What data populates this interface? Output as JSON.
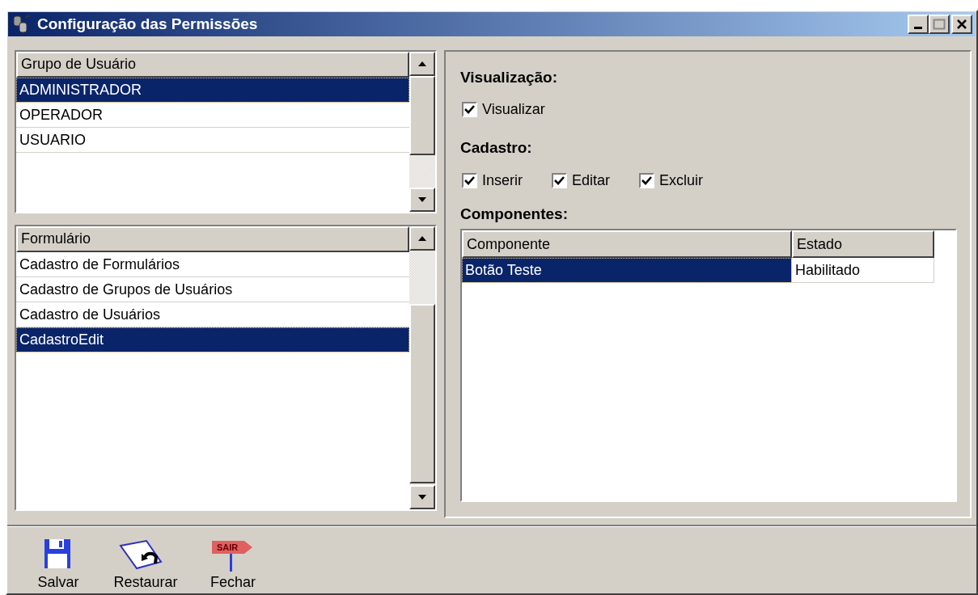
{
  "window": {
    "title": "Configuração das Permissões"
  },
  "user_groups": {
    "header": "Grupo de Usuário",
    "items": [
      {
        "label": "ADMINISTRADOR",
        "selected": true
      },
      {
        "label": "OPERADOR",
        "selected": false
      },
      {
        "label": "USUARIO",
        "selected": false
      }
    ]
  },
  "forms": {
    "header": "Formulário",
    "items": [
      {
        "label": "Cadastro de Formulários",
        "selected": false
      },
      {
        "label": "Cadastro de Grupos de Usuários",
        "selected": false
      },
      {
        "label": "Cadastro de Usuários",
        "selected": false
      },
      {
        "label": "CadastroEdit",
        "selected": true
      }
    ]
  },
  "sections": [
    {
      "title": "Visualização:",
      "options": [
        {
          "label": "Visualizar",
          "checked": true
        }
      ]
    },
    {
      "title": "Cadastro:",
      "options": [
        {
          "label": "Inserir",
          "checked": true
        },
        {
          "label": "Editar",
          "checked": true
        },
        {
          "label": "Excluir",
          "checked": true
        }
      ]
    }
  ],
  "components": {
    "title": "Componentes:",
    "columns": [
      "Componente",
      "Estado"
    ],
    "rows": [
      {
        "cells": [
          "Botão Teste",
          "Habilitado"
        ],
        "selected": true
      }
    ]
  },
  "toolbar": [
    {
      "kind": "save",
      "label": "Salvar"
    },
    {
      "kind": "restore",
      "label": "Restaurar"
    },
    {
      "kind": "exit",
      "label": "Fechar",
      "sign": "SAIR"
    }
  ]
}
